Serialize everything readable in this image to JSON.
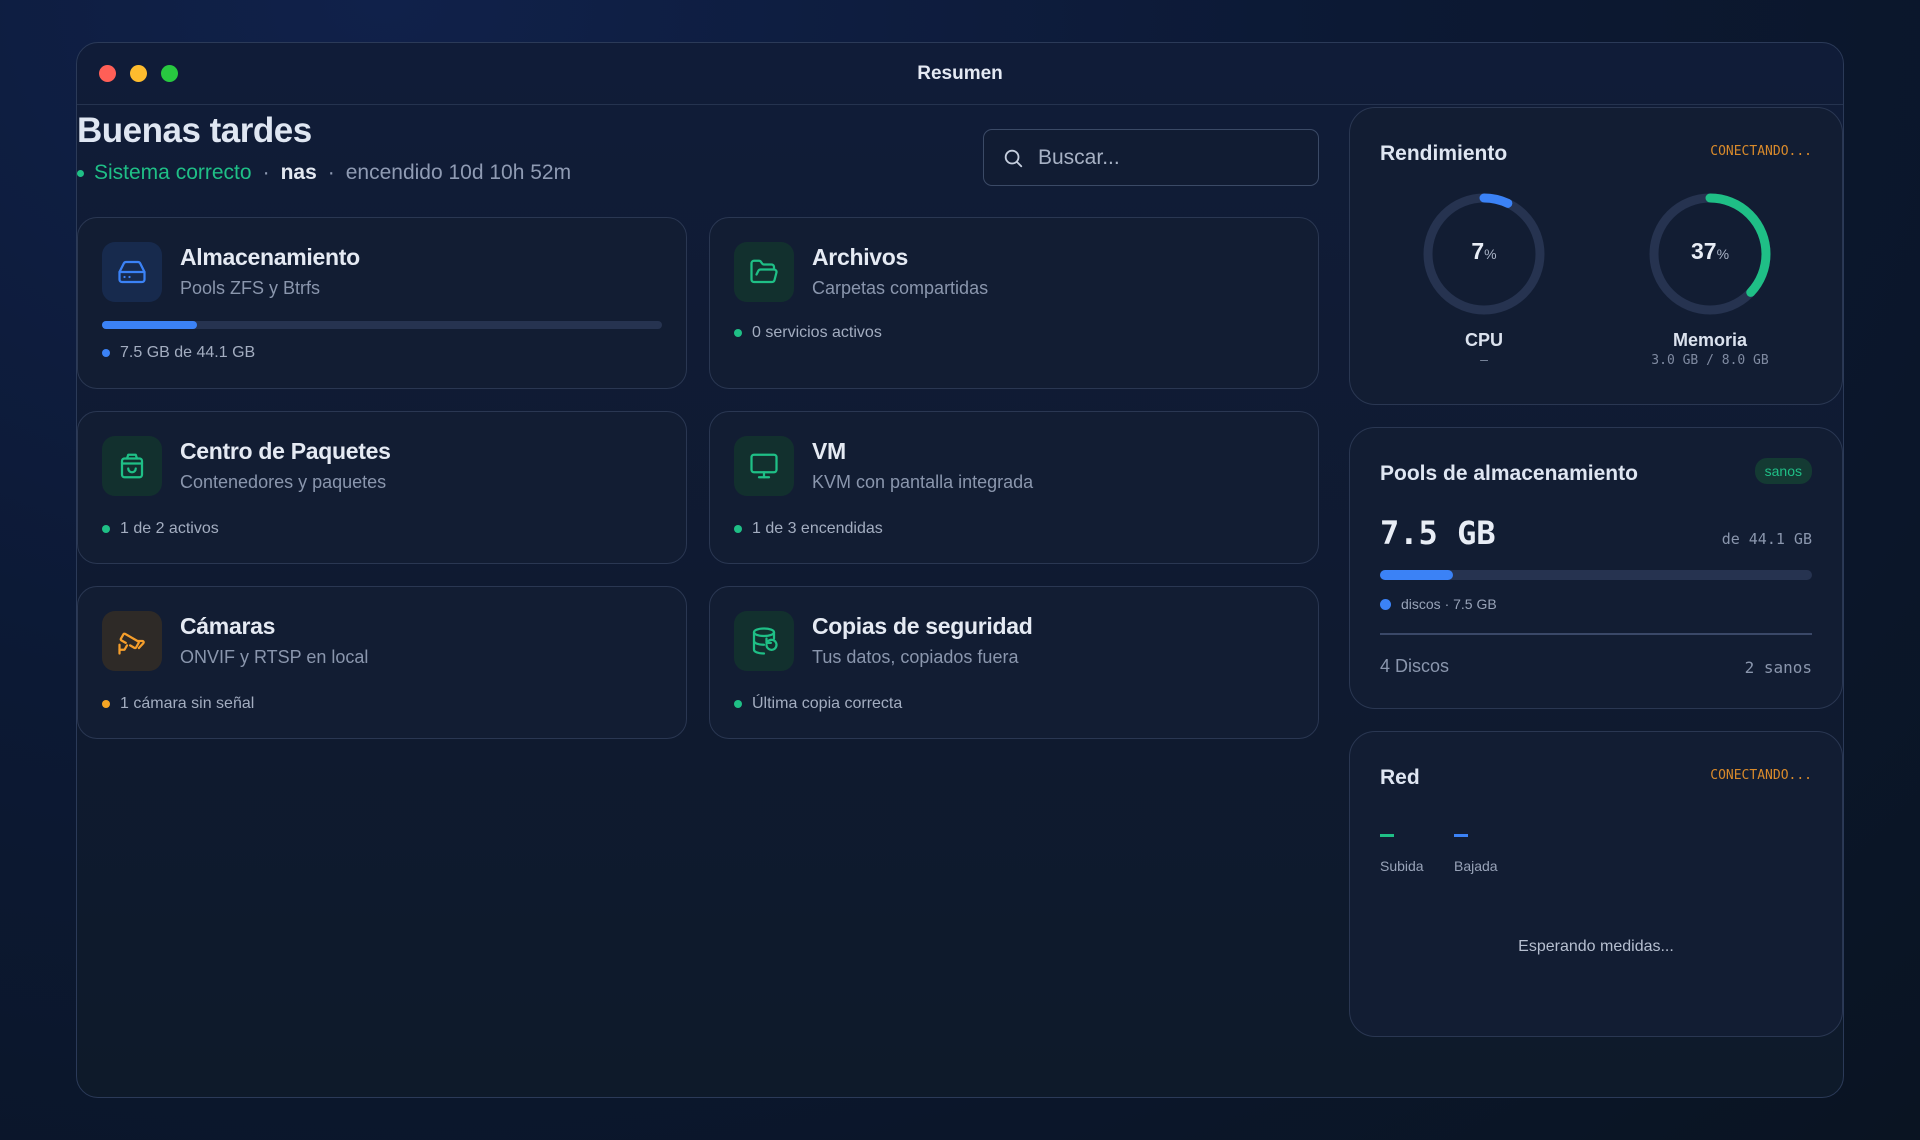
{
  "window": {
    "title": "Resumen"
  },
  "greeting": {
    "title": "Buenas tardes",
    "status": "Sistema correcto",
    "host": "nas",
    "uptime": "encendido 10d 10h 52m"
  },
  "search": {
    "placeholder": "Buscar..."
  },
  "cards": [
    {
      "title": "Almacenamiento",
      "subtitle": "Pools ZFS y Btrfs",
      "footer": "7.5 GB de 44.1 GB",
      "icon": "hard-drive-icon",
      "progress": 0.17,
      "status_color": "#3b82f6"
    },
    {
      "title": "Archivos",
      "subtitle": "Carpetas compartidas",
      "footer": "0 servicios activos",
      "icon": "folder-open-icon",
      "status_color": "#1fbf86"
    },
    {
      "title": "Centro de Paquetes",
      "subtitle": "Contenedores y paquetes",
      "footer": "1 de 2 activos",
      "icon": "shopping-bag-icon",
      "status_color": "#1fbf86"
    },
    {
      "title": "VM",
      "subtitle": "KVM con pantalla integrada",
      "footer": "1 de 3 encendidas",
      "icon": "monitor-icon",
      "status_color": "#1fbf86"
    },
    {
      "title": "Cámaras",
      "subtitle": "ONVIF y RTSP en local",
      "footer": "1 cámara sin señal",
      "icon": "cctv-camera-icon",
      "status_color": "#f5a524"
    },
    {
      "title": "Copias de seguridad",
      "subtitle": "Tus datos, copiados fuera",
      "footer": "Última copia correcta",
      "icon": "database-backup-icon",
      "status_color": "#1fbf86"
    }
  ],
  "performance": {
    "title": "Rendimiento",
    "state": "CONECTANDO...",
    "cpu": {
      "value": "7",
      "unit": "%",
      "label": "CPU",
      "detail": "—",
      "fraction": 0.07,
      "color": "#3b82f6"
    },
    "memory": {
      "value": "37",
      "unit": "%",
      "label": "Memoria",
      "detail": "3.0 GB / 8.0 GB",
      "fraction": 0.37,
      "color": "#1fbf86"
    }
  },
  "pools": {
    "title": "Pools de almacenamiento",
    "badge": "sanos",
    "used": "7.5 GB",
    "total": "de 44.1 GB",
    "fraction": 0.17,
    "legend": "discos · 7.5 GB",
    "disks": "4 Discos",
    "healthy": "2 sanos"
  },
  "network": {
    "title": "Red",
    "state": "CONECTANDO...",
    "upload_label": "Subida",
    "download_label": "Bajada",
    "waiting": "Esperando medidas..."
  },
  "colors": {
    "accent_blue": "#3b82f6",
    "accent_green": "#1fbf86",
    "warning": "#f5a524"
  }
}
